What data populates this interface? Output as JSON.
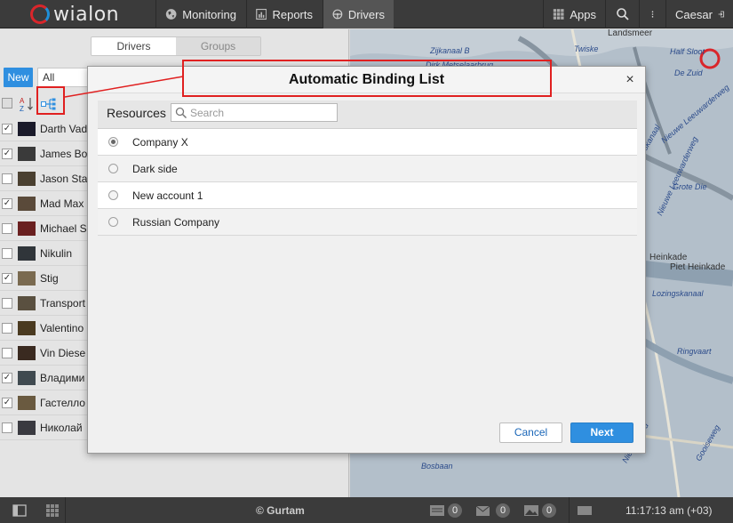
{
  "header": {
    "logo_text": "wialon",
    "nav": [
      {
        "label": "Monitoring",
        "icon": "globe-icon"
      },
      {
        "label": "Reports",
        "icon": "report-icon"
      },
      {
        "label": "Drivers",
        "icon": "steering-wheel-icon"
      }
    ],
    "apps_label": "Apps",
    "user_label": "Caesar"
  },
  "left_panel": {
    "tabs": [
      "Drivers",
      "Groups"
    ],
    "new_button": "New",
    "filter_value": "All",
    "drivers": [
      {
        "name": "Darth Vad",
        "checked": true
      },
      {
        "name": "James Bo",
        "checked": true
      },
      {
        "name": "Jason Sta",
        "checked": false
      },
      {
        "name": "Mad Max",
        "checked": true
      },
      {
        "name": "Michael S",
        "checked": false
      },
      {
        "name": "Nikulin",
        "checked": false
      },
      {
        "name": "Stig",
        "checked": true
      },
      {
        "name": "Transport",
        "checked": false
      },
      {
        "name": "Valentino",
        "checked": false
      },
      {
        "name": "Vin Diese",
        "checked": false
      },
      {
        "name": "Владими",
        "checked": true
      },
      {
        "name": "Гастелло",
        "checked": true
      },
      {
        "name": "Николай",
        "checked": false
      }
    ]
  },
  "map": {
    "labels": [
      "Landsmeer",
      "Zijkanaal B",
      "Twiske",
      "Half Sloot",
      "De Zuid",
      "Dirk Metselaarbrug",
      "Nieuwe Leeuwarderweg",
      "Grote Die",
      "Heimanskanaal",
      "Nieuwe Leeuwarderweg",
      "Heinkade",
      "Piet Heinkade",
      "Lozingskanaal",
      "Ringvaart",
      "Bosbaan",
      "Gooiseweg",
      "Nieuwe Zuid"
    ]
  },
  "modal": {
    "title": "Automatic Binding List",
    "close": "×",
    "resources_label": "Resources",
    "search_placeholder": "Search",
    "resources": [
      {
        "name": "Company X",
        "selected": true
      },
      {
        "name": "Dark side",
        "selected": false
      },
      {
        "name": "New account 1",
        "selected": false
      },
      {
        "name": "Russian Company",
        "selected": false
      }
    ],
    "cancel_label": "Cancel",
    "next_label": "Next"
  },
  "footer": {
    "copyright": "© Gurtam",
    "counts": [
      "0",
      "0",
      "0"
    ],
    "time": "11:17:13 am (+03)"
  },
  "colors": {
    "accent": "#2f8fe0",
    "callout": "#e02020",
    "topbar": "#3b3b3b"
  }
}
